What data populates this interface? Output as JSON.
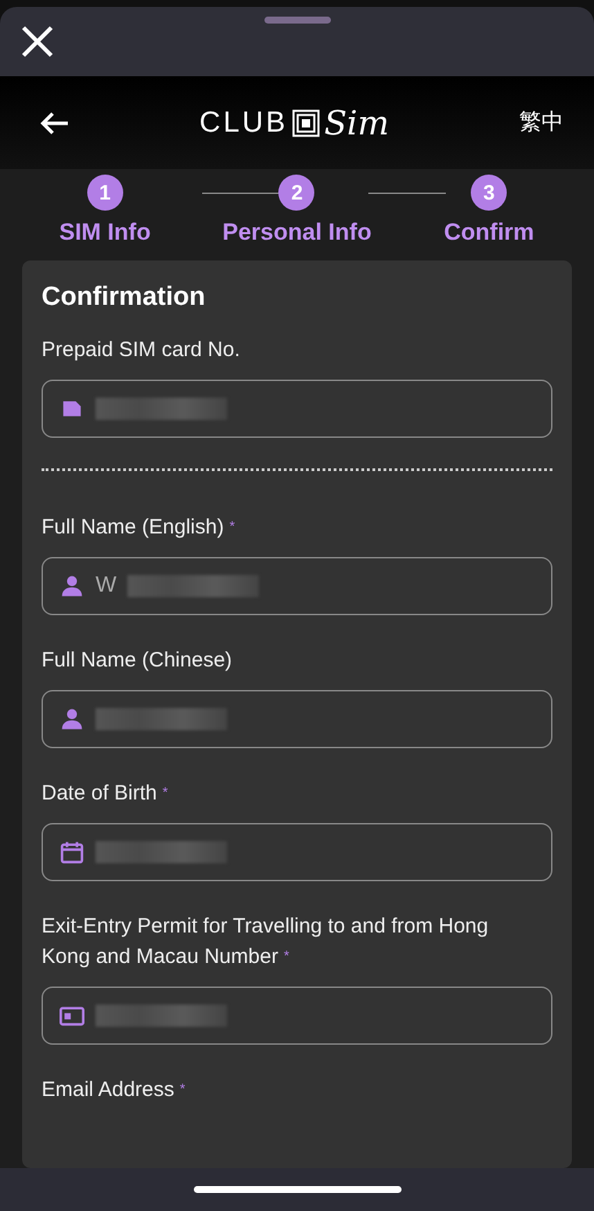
{
  "nav": {
    "language": "繁中",
    "logo": {
      "left": "CLUB",
      "right": "Sim"
    }
  },
  "steps": [
    {
      "number": "1",
      "label": "SIM Info"
    },
    {
      "number": "2",
      "label": "Personal Info"
    },
    {
      "number": "3",
      "label": "Confirm"
    }
  ],
  "card": {
    "title": "Confirmation",
    "fields": [
      {
        "label": "Prepaid SIM card No.",
        "kind": "sim",
        "divider_after": true
      },
      {
        "label": "Full Name (English)",
        "required_mark": "*",
        "kind": "person",
        "value": "W"
      },
      {
        "label": "Full Name (Chinese)",
        "kind": "person"
      },
      {
        "label": "Date of Birth",
        "required_mark": "*",
        "kind": "calendar"
      },
      {
        "label": "Exit-Entry Permit for Travelling to and from Hong Kong and Macau Number",
        "required_mark": "*",
        "kind": "card"
      },
      {
        "label": "Email Address",
        "required_mark": "*",
        "kind": "none"
      }
    ]
  }
}
